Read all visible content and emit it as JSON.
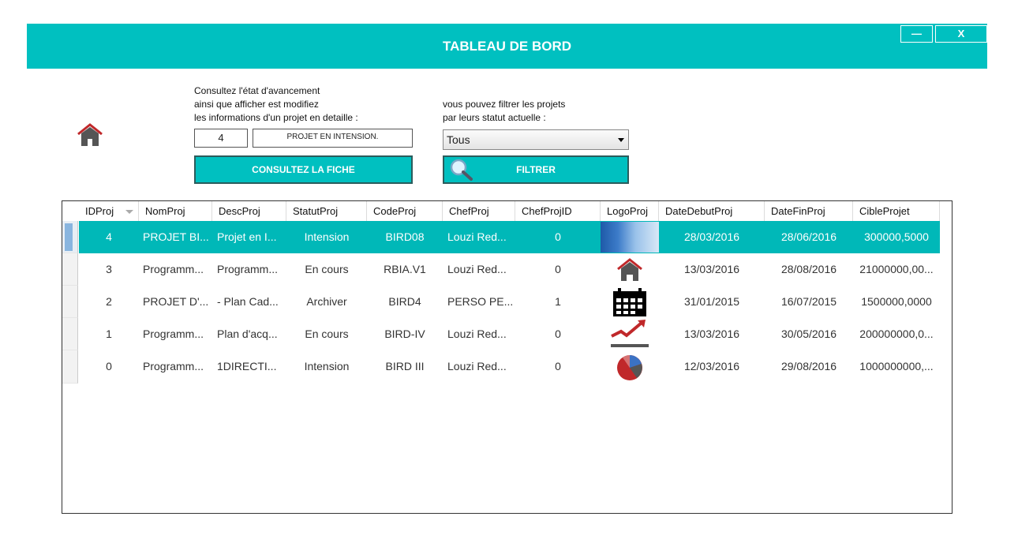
{
  "window": {
    "title": "TABLEAU DE BORD",
    "minimize_label": "—",
    "close_label": "X"
  },
  "consult": {
    "description": "Consultez l'état d'avancement\nainsi que afficher est modifiez\nles informations d'un projet en detaille :",
    "id_value": "4",
    "status_value": "PROJET EN INTENSION.",
    "button_label": "CONSULTEZ LA FICHE"
  },
  "filter": {
    "description": "vous pouvez filtrer les projets\npar leurs statut actuelle :",
    "selected": "Tous",
    "button_label": "FILTRER"
  },
  "grid": {
    "columns": [
      "IDProj",
      "NomProj",
      "DescProj",
      "StatutProj",
      "CodeProj",
      "ChefProj",
      "ChefProjID",
      "LogoProj",
      "DateDebutProj",
      "DateFinProj",
      "CibleProjet"
    ],
    "rows": [
      {
        "id": "4",
        "nom": "PROJET BI...",
        "desc": "Projet en I...",
        "statut": "Intension",
        "code": "BIRD08",
        "chef": "Louzi Red...",
        "chefid": "0",
        "logo": "building-photo",
        "debut": "28/03/2016",
        "fin": "28/06/2016",
        "cible": "300000,5000"
      },
      {
        "id": "3",
        "nom": "Programm...",
        "desc": "Programm...",
        "statut": "En cours",
        "code": "RBIA.V1",
        "chef": "Louzi Red...",
        "chefid": "0",
        "logo": "home-icon",
        "debut": "13/03/2016",
        "fin": "28/08/2016",
        "cible": "21000000,00..."
      },
      {
        "id": "2",
        "nom": "PROJET D'...",
        "desc": "- Plan Cad...",
        "statut": "Archiver",
        "code": "BIRD4",
        "chef": "PERSO PE...",
        "chefid": "1",
        "logo": "calendar-icon",
        "debut": "31/01/2015",
        "fin": "16/07/2015",
        "cible": "1500000,0000"
      },
      {
        "id": "1",
        "nom": "Programm...",
        "desc": "Plan d'acq...",
        "statut": "En cours",
        "code": "BIRD-IV",
        "chef": "Louzi Red...",
        "chefid": "0",
        "logo": "trend-chart-icon",
        "debut": "13/03/2016",
        "fin": "30/05/2016",
        "cible": "200000000,0..."
      },
      {
        "id": "0",
        "nom": "Programm...",
        "desc": "1DIRECTI...",
        "statut": "Intension",
        "code": "BIRD III",
        "chef": "Louzi Red...",
        "chefid": "0",
        "logo": "pie-chart-icon",
        "debut": "12/03/2016",
        "fin": "29/08/2016",
        "cible": "1000000000,..."
      }
    ],
    "selected_row": 0
  },
  "colors": {
    "accent": "#00c0c0",
    "selected_row": "#00b8b8",
    "icon_red": "#c0282a"
  }
}
